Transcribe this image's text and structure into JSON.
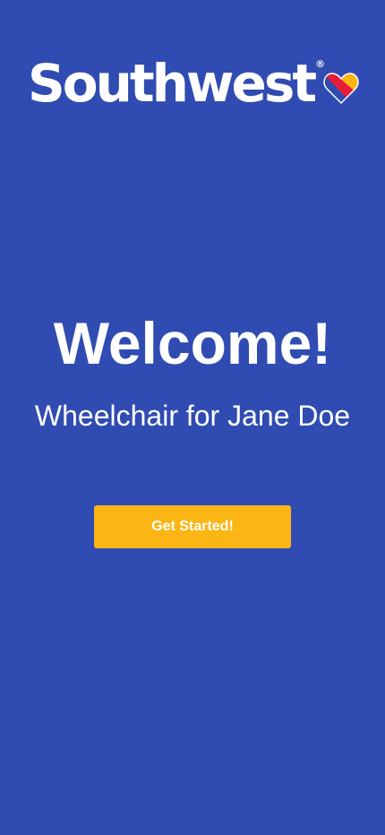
{
  "brand": {
    "name": "Southwest",
    "registered_mark": "®",
    "logo_icon": "heart-icon",
    "colors": {
      "blue": "#304cb2",
      "red": "#e61c38",
      "yellow": "#fbb615",
      "heart_blue": "#304cb2"
    }
  },
  "main": {
    "title": "Welcome!",
    "subtitle": "Wheelchair for Jane Doe",
    "cta_label": "Get Started!"
  }
}
